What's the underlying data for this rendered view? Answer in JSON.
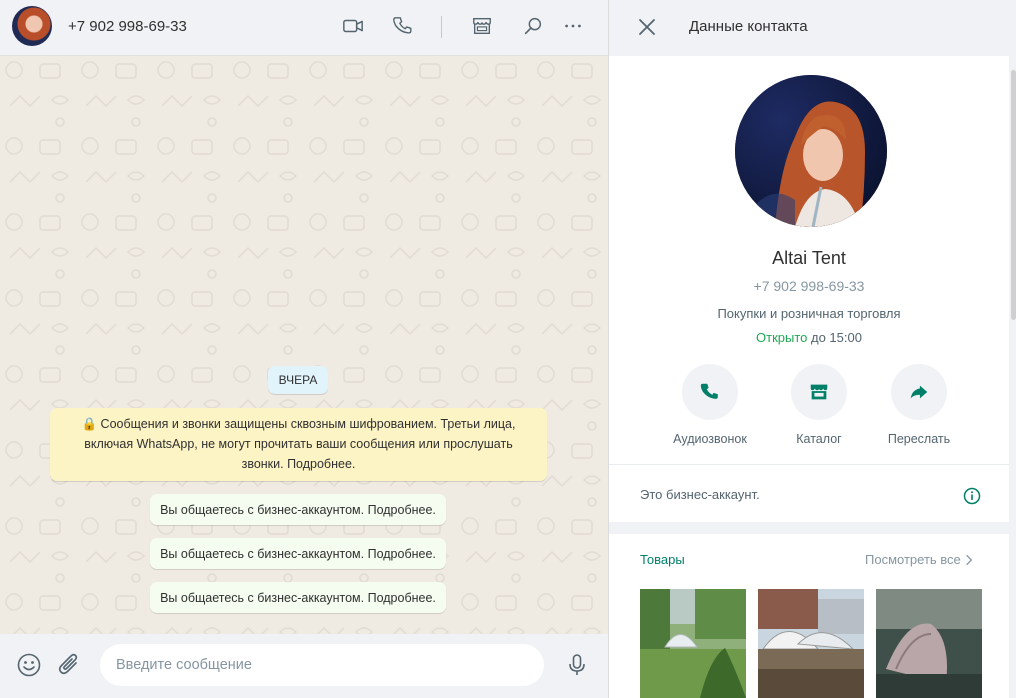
{
  "chat": {
    "header": {
      "phone": "+7 902 998-69-33"
    },
    "day_chip": "ВЧЕРА",
    "system_message": "🔒 Сообщения и звонки защищены сквозным шифрованием. Третьи лица, включая WhatsApp, не могут прочитать ваши сообщения или прослушать звонки. Подробнее.",
    "business_messages": [
      "Вы общаетесь с бизнес-аккаунтом. Подробнее.",
      "Вы общаетесь с бизнес-аккаунтом. Подробнее.",
      "Вы общаетесь с бизнес-аккаунтом. Подробнее."
    ],
    "composer": {
      "placeholder": "Введите сообщение"
    },
    "icons": [
      "video-call-icon",
      "phone-icon",
      "catalog-icon",
      "search-icon",
      "more-icon",
      "emoji-icon",
      "attach-icon",
      "mic-icon"
    ]
  },
  "contact": {
    "header_title": "Данные контакта",
    "name": "Altai Tent",
    "phone": "+7 902 998-69-33",
    "category": "Покупки и розничная торговля",
    "hours": {
      "open_word": "Открыто",
      "until": " до 15:00"
    },
    "actions": [
      {
        "label": "Аудиозвонок",
        "icon": "phone-icon"
      },
      {
        "label": "Каталог",
        "icon": "store-icon"
      },
      {
        "label": "Переслать",
        "icon": "forward-icon"
      }
    ],
    "business_note": "Это бизнес-аккаунт.",
    "products": {
      "title": "Товары",
      "see_all": "Посмотреть все"
    }
  },
  "colors": {
    "accent_green": "#008069",
    "open_green": "#1fa855",
    "system_bubble": "#fdf4c5",
    "business_bubble": "#f5fdf1",
    "day_chip": "#e1f3fb",
    "panel_bg": "#f0f2f5"
  }
}
